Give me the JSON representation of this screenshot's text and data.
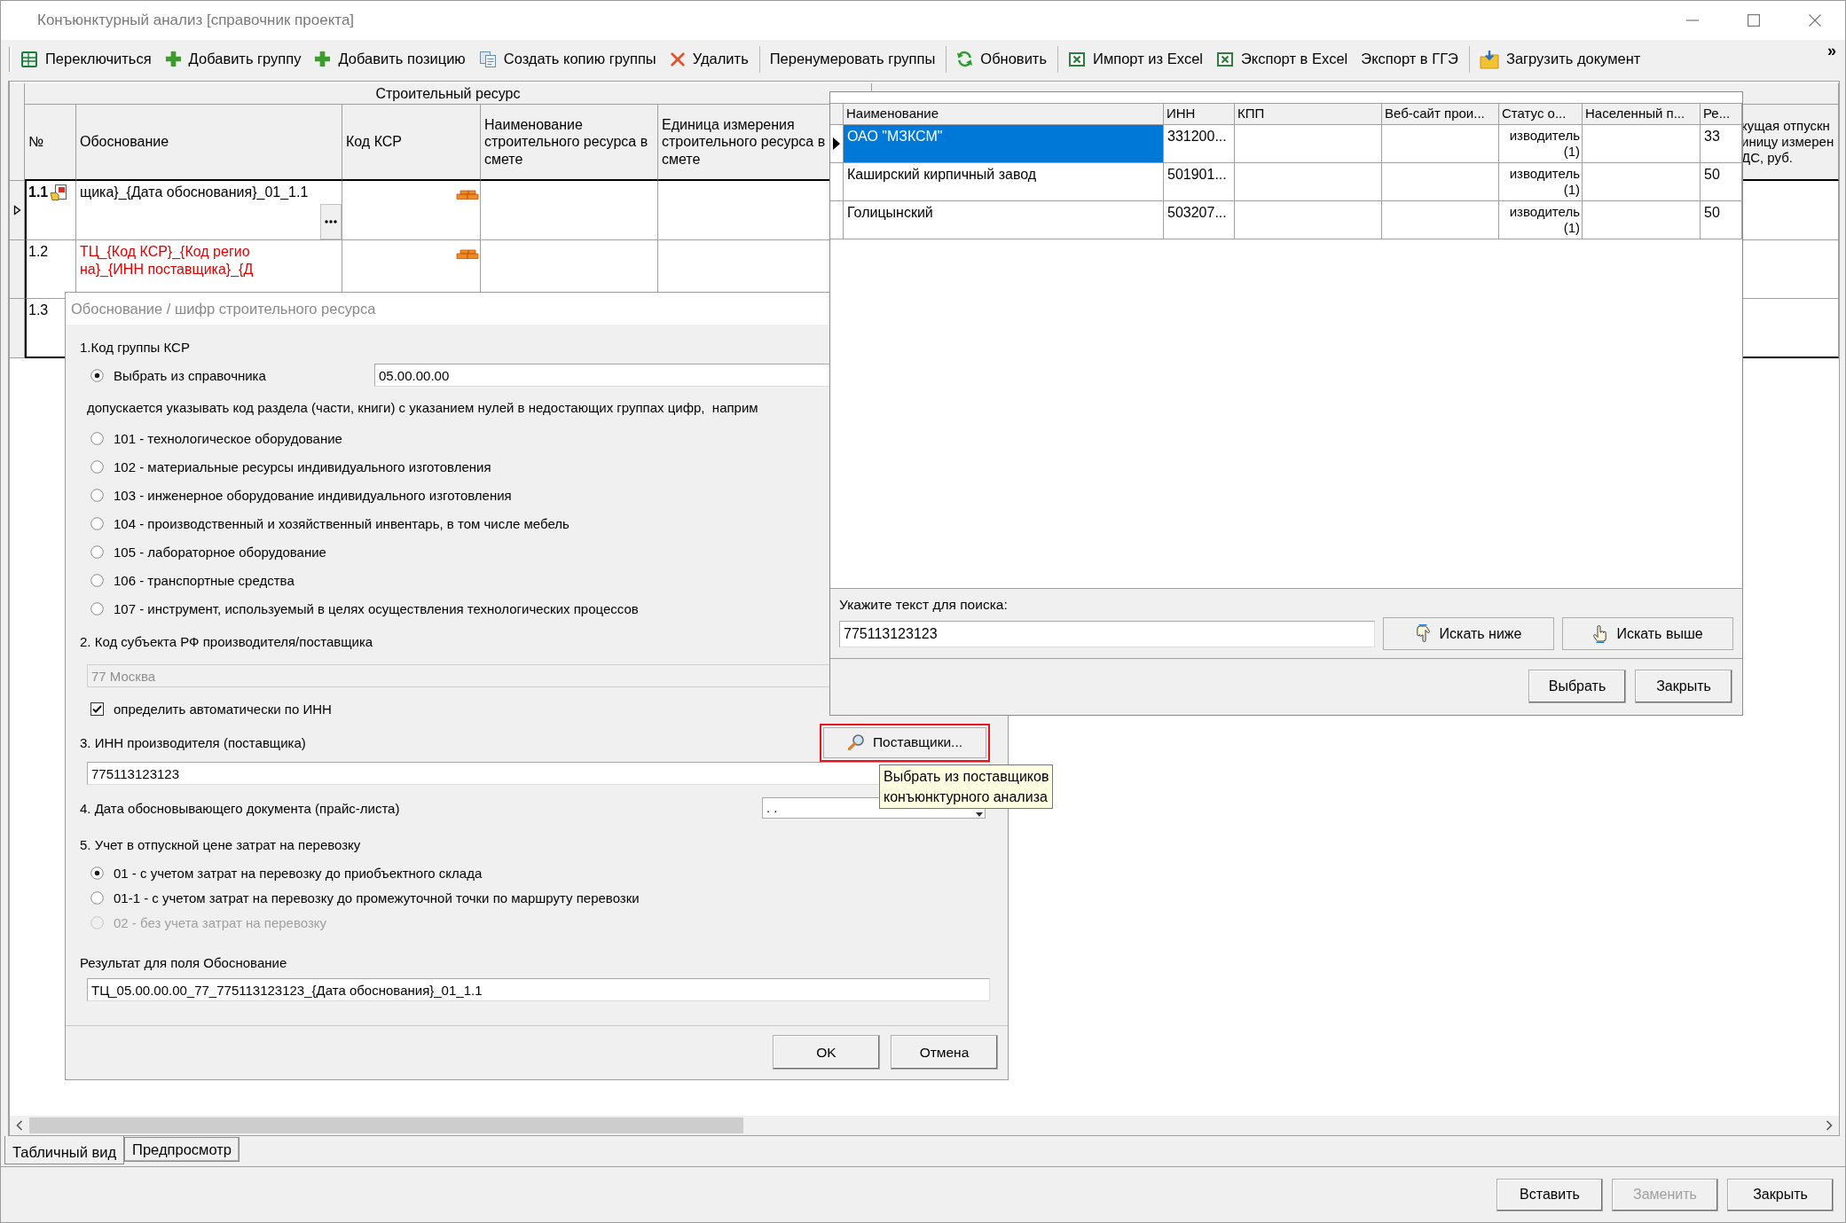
{
  "window": {
    "title": "Конъюнктурный анализ [справочник проекта]"
  },
  "toolbar": {
    "items": [
      {
        "kind": "button",
        "label": "Переключиться"
      },
      {
        "kind": "button",
        "label": "Добавить группу"
      },
      {
        "kind": "button",
        "label": "Добавить позицию"
      },
      {
        "kind": "button",
        "label": "Создать копию группы"
      },
      {
        "kind": "button",
        "label": "Удалить"
      },
      {
        "kind": "separator"
      },
      {
        "kind": "button",
        "label": "Перенумеровать группы"
      },
      {
        "kind": "separator"
      },
      {
        "kind": "button",
        "label": "Обновить"
      },
      {
        "kind": "separator"
      },
      {
        "kind": "button",
        "label": "Импорт из Excel"
      },
      {
        "kind": "button",
        "label": "Экспорт в Excel"
      },
      {
        "kind": "button",
        "label": "Экспорт в ГГЭ"
      },
      {
        "kind": "separator"
      },
      {
        "kind": "button",
        "label": "Загрузить документ"
      }
    ],
    "overflow": "»"
  },
  "main_grid": {
    "group_header": "Строительный ресурс",
    "columns": [
      "№",
      "Обоснование",
      "Код КСР",
      "Наименование строительного ресурса в смете",
      "Единица измерения строительного ресурса в смете"
    ],
    "last_column": "кущая отпускн\nиницу измерен\nДС, руб.",
    "rows": [
      {
        "number": "1.1",
        "current": true,
        "justification": "щика}_{Дата обоснования}_01_1.1",
        "invalid": false,
        "brick": true
      },
      {
        "number": "1.2",
        "current": false,
        "justification": "ТЦ_{Код КСР}_{Код регио\nна}_{ИНН поставщика}_{Д",
        "invalid": true,
        "brick": true
      },
      {
        "number": "1.3",
        "current": false
      }
    ]
  },
  "supplier_lookup": {
    "columns": [
      "Наименование",
      "ИНН",
      "КПП",
      "Веб-сайт прои...",
      "Статус о...",
      "Населенный п...",
      "Ре..."
    ],
    "rows": [
      {
        "selected": true,
        "name": "ОАО \"МЗКСМ\"",
        "inn": "331200...",
        "status": "изводитель (1)",
        "column_7": "33"
      },
      {
        "selected": false,
        "name": "Каширский кирпичный завод",
        "inn": "501901...",
        "status": "изводитель (1)",
        "column_7": "50"
      },
      {
        "selected": false,
        "name": "Голицынский",
        "inn": "503207...",
        "status": "изводитель (1)",
        "column_7": "50"
      }
    ],
    "search": {
      "label": "Укажите текст для поиска:",
      "value": "775113123123",
      "buttons": [
        {
          "kind": "down",
          "label": "Искать ниже"
        },
        {
          "kind": "up",
          "label": "Искать выше"
        }
      ]
    },
    "buttons": [
      "Выбрать",
      "Закрыть"
    ]
  },
  "justification_dialog": {
    "title": "Обоснование / шифр строительного ресурса",
    "ksr_group": {
      "label": "1.Код группы КСР",
      "directory": {
        "label": "Выбрать из справочника",
        "selected": true,
        "value": "05.00.00.00"
      },
      "hint": "допускается указывать код раздела (части, книги) с указанием нулей в недостающих группах цифр,  наприм",
      "options": [
        {
          "label": "101 - технологическое оборудование",
          "selected": false
        },
        {
          "label": "102 - материальные ресурсы индивидуального изготовления",
          "selected": false
        },
        {
          "label": "103 - инженерное оборудование индивидуального изготовления",
          "selected": false
        },
        {
          "label": "104 - производственный и хозяйственный инвентарь, в том числе мебель",
          "selected": false
        },
        {
          "label": "105 - лабораторное оборудование",
          "selected": false
        },
        {
          "label": "106 - транспортные средства",
          "selected": false
        },
        {
          "label": "107 - инструмент, используемый в целях осуществления технологических процессов",
          "selected": false
        }
      ]
    },
    "region": {
      "label": "2. Код субъекта РФ производителя/поставщика",
      "value": "77 Москва",
      "disabled": true,
      "auto_by_inn": {
        "label": "определить автоматически по ИНН",
        "checked": true
      }
    },
    "inn": {
      "label": "3. ИНН производителя (поставщика)",
      "value": "775113123123",
      "suppliers_button": {
        "label": "Поставщики...",
        "highlighted": true
      }
    },
    "document_date": {
      "label": "4. Дата обосновывающего документа (прайс-листа)",
      "value": ". ."
    },
    "transport": {
      "label": "5. Учет в отпускной цене затрат на перевозку",
      "options": [
        {
          "label": "01 - с учетом затрат на перевозку до приобъектного склада",
          "selected": true,
          "disabled": false
        },
        {
          "label": "01-1 - с учетом затрат на перевозку до промежуточной точки по маршруту перевозки",
          "selected": false,
          "disabled": false
        },
        {
          "label": "02 - без учета затрат на перевозку",
          "selected": false,
          "disabled": true
        }
      ]
    },
    "result": {
      "label": "Результат для поля Обоснование",
      "value": "ТЦ_05.00.00.00_77_775113123123_{Дата обоснования}_01_1.1"
    },
    "buttons": [
      "OK",
      "Отмена"
    ]
  },
  "tooltip": "Выбрать из поставщиков\nконъюнктурного анализа",
  "view_tabs": [
    {
      "label": "Табличный вид",
      "selected": true
    },
    {
      "label": "Предпросмотр",
      "selected": false
    }
  ],
  "footer_buttons": [
    {
      "label": "Вставить",
      "disabled": false
    },
    {
      "label": "Заменить",
      "disabled": true
    },
    {
      "label": "Закрыть",
      "disabled": false
    }
  ]
}
